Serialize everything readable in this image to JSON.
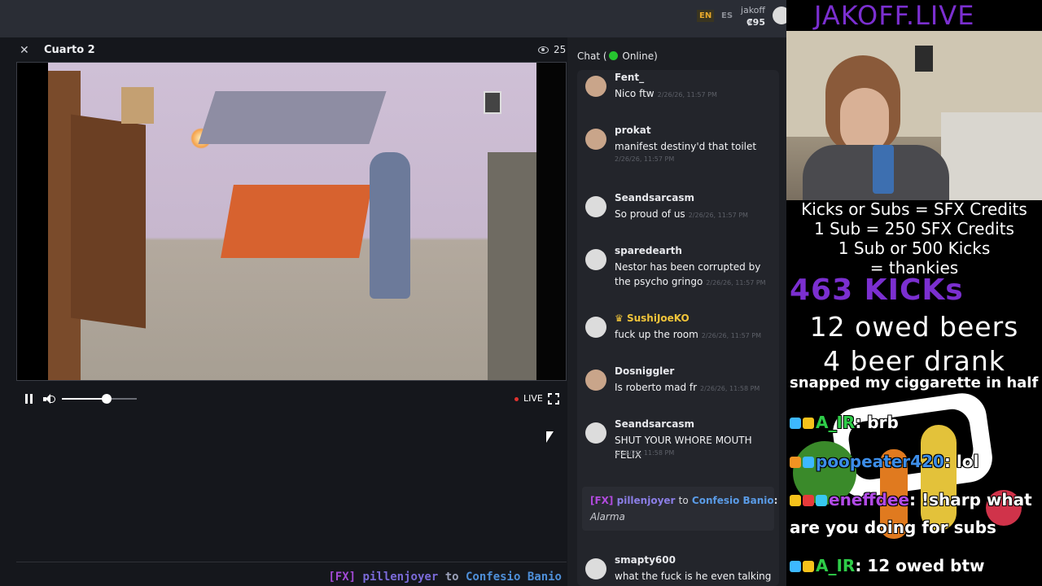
{
  "topbar": {
    "lang_en": "EN",
    "lang_es": "ES",
    "username": "jakoff",
    "credits": "₡95"
  },
  "room": {
    "title": "Cuarto 2",
    "viewer_count": "25"
  },
  "player": {
    "live_label": "LIVE",
    "volume_fraction": 0.6
  },
  "ticker": {
    "tag": "[FX]",
    "user": "pillenjoyer",
    "to": "to",
    "target": "Confesio Banio"
  },
  "chat": {
    "header_prefix": "Chat (",
    "header_status": "Online)",
    "messages": [
      {
        "user": "Fent_",
        "text": "Nico ftw",
        "time": "2/26/26, 11:57 PM"
      },
      {
        "user": "prokat",
        "text": "manifest destiny'd that toilet",
        "time": "2/26/26, 11:57 PM"
      },
      {
        "user": "Seandsarcasm",
        "text": "So proud of us",
        "time": "2/26/26, 11:57 PM"
      },
      {
        "user": "sparedearth",
        "text": "Nestor has been corrupted by the psycho gringo",
        "time": "2/26/26, 11:57 PM"
      },
      {
        "user": "SushiJoeKO",
        "text": "fuck up the room",
        "time": "2/26/26, 11:57 PM"
      },
      {
        "user": "Dosniggler",
        "text": "Is roberto mad fr",
        "time": "2/26/26, 11:58 PM"
      },
      {
        "user": "Seandsarcasm",
        "text": "SHUT YOUR WHORE MOUTH FELIX",
        "time": "2/26/26, 11:58 PM"
      },
      {
        "user": "smapty600",
        "text": "what the fuck is he even talking",
        "time": ""
      }
    ],
    "fx": {
      "tag": "[FX]",
      "user": "pillenjoyer",
      "to": "to",
      "target": "Confesio Banio",
      "colon": ":",
      "text": "Alarma"
    }
  },
  "overlay": {
    "title": "JAKOFF.LIVE",
    "info_lines": [
      "Kicks or Subs = SFX Credits",
      "1 Sub = 250 SFX Credits",
      "1 Sub or 500 Kicks",
      "= thankies"
    ],
    "kicks": "463 KICKs",
    "owed_beers": "12 owed beers",
    "beer_drank": "4 beer drank",
    "alert": "snapped my ciggarette in half",
    "chat": [
      {
        "name": "A_IR",
        "text": ": brb"
      },
      {
        "name": "poopeater420",
        "text": ": lol"
      },
      {
        "name": "eneffdee",
        "text": ": !sharp what"
      },
      {
        "name": "",
        "text": "are you doing for subs"
      },
      {
        "name": "A_IR",
        "text": ": 12 owed btw"
      }
    ]
  },
  "colors": {
    "accent_purple": "#7b2fd0",
    "online_green": "#26c42f",
    "live_red": "#e0322f",
    "gold": "#f0c43a"
  }
}
